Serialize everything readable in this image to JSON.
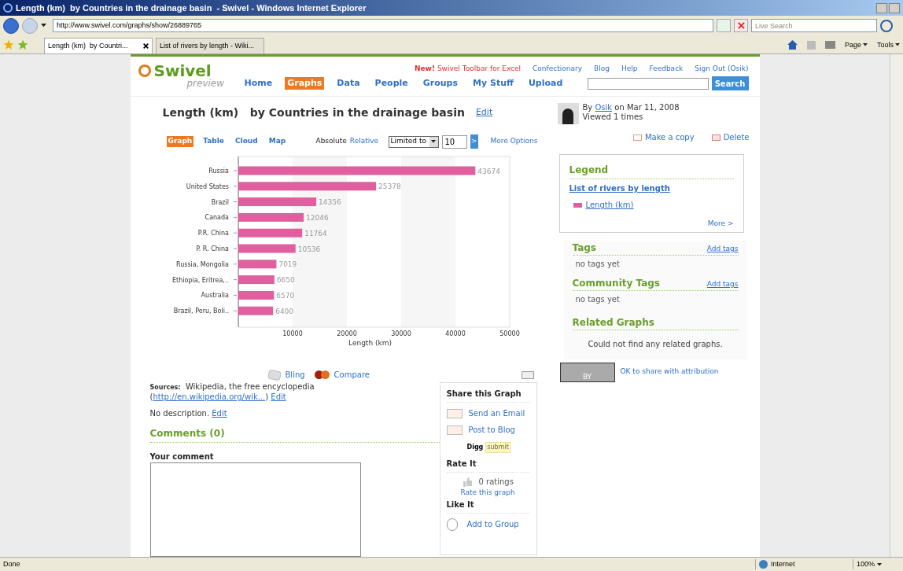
{
  "browser": {
    "title": "Length (km)  by Countries in the drainage basin  - Swivel - Windows Internet Explorer",
    "url": "http://www.swivel.com/graphs/show/26889765",
    "search_placeholder": "Live Search",
    "tabs": [
      {
        "label": "Length (km)  by Countri...",
        "selected": true
      },
      {
        "label": "List of rivers by length - Wiki...",
        "selected": false
      }
    ],
    "tools": [
      "Page",
      "Tools"
    ],
    "status": "Done",
    "zone": "Internet",
    "zoom": "100%"
  },
  "site": {
    "logo": "Swivel",
    "logo_sub": "preview",
    "promo_badge": "New!",
    "promo": "Swivel Toolbar for Excel",
    "top_links": [
      "Confectionary",
      "Blog",
      "Help",
      "Feedback",
      "Sign Out (Osik)"
    ],
    "nav": [
      {
        "label": "Home",
        "selected": false
      },
      {
        "label": "Graphs",
        "selected": true
      },
      {
        "label": "Data",
        "selected": false
      },
      {
        "label": "People",
        "selected": false
      },
      {
        "label": "Groups",
        "selected": false
      },
      {
        "label": "My Stuff",
        "selected": false
      },
      {
        "label": "Upload",
        "selected": false
      }
    ],
    "search_button": "Search"
  },
  "graph": {
    "title": "Length (km)   by Countries in the drainage basin",
    "edit": "Edit",
    "views": [
      {
        "label": "Graph",
        "selected": true
      },
      {
        "label": "Table",
        "selected": false
      },
      {
        "label": "Cloud",
        "selected": false
      },
      {
        "label": "Map",
        "selected": false
      }
    ],
    "scales": [
      {
        "label": "Absolute",
        "selected": true
      },
      {
        "label": "Relative",
        "selected": false
      }
    ],
    "limit_select": "Limited to",
    "limit_value": "10",
    "go": ">",
    "more_options": "More Options",
    "chart_data": {
      "type": "bar",
      "orientation": "horizontal",
      "xlabel": "Length (km)",
      "categories": [
        "Russia",
        "United States",
        "Brazil",
        "Canada",
        "P.R. China",
        "P. R. China",
        "Russia, Mongolia",
        "Ethiopia, Eritrea,..",
        "Australia",
        "Brazil, Peru, Boli.."
      ],
      "series": [
        {
          "name": "Length (km)",
          "color": "#e0609f",
          "values": [
            43674,
            25378,
            14356,
            12046,
            11764,
            10536,
            7019,
            6650,
            6570,
            6400
          ]
        }
      ],
      "xlim": [
        0,
        50000
      ],
      "xticks": [
        10000,
        20000,
        30000,
        40000,
        50000
      ],
      "data_labels": true
    },
    "actions": [
      "Bling",
      "Compare"
    ]
  },
  "details": {
    "sources_label": "Sources:",
    "sources": "Wikipedia, the free encyclopedia",
    "source_open": "(",
    "source_link": "http://en.wikipedia.org/wik...",
    "source_close": ")",
    "source_edit": "Edit",
    "description": "No description.",
    "description_edit": "Edit",
    "comments": "Comments (0)",
    "your_comment": "Your comment"
  },
  "share": {
    "title": "Share this Graph",
    "items": [
      "Send an Email",
      "Post to Blog"
    ],
    "digg": "Digg",
    "digg_button": "submit",
    "rate_title": "Rate It",
    "ratings": "0 ratings",
    "rate_link": "Rate this graph",
    "like_title": "Like It",
    "like_items": [
      "Add to Group"
    ]
  },
  "author": {
    "by": "By",
    "name": "Osik",
    "date": "on Mar 11, 2008",
    "views": "Viewed 1 times",
    "copy": "Make a copy",
    "delete": "Delete"
  },
  "legend": {
    "title": "Legend",
    "dataset": "List of rivers by length",
    "more": "More >"
  },
  "tags": {
    "title": "Tags",
    "add": "Add tags",
    "empty": "no tags yet",
    "community_title": "Community Tags",
    "community_add": "Add tags",
    "community_empty": "no tags yet",
    "related_title": "Related Graphs",
    "related_empty": "Could not find any related graphs."
  },
  "license": {
    "text": "OK to share with attribution",
    "badge": "BY"
  }
}
